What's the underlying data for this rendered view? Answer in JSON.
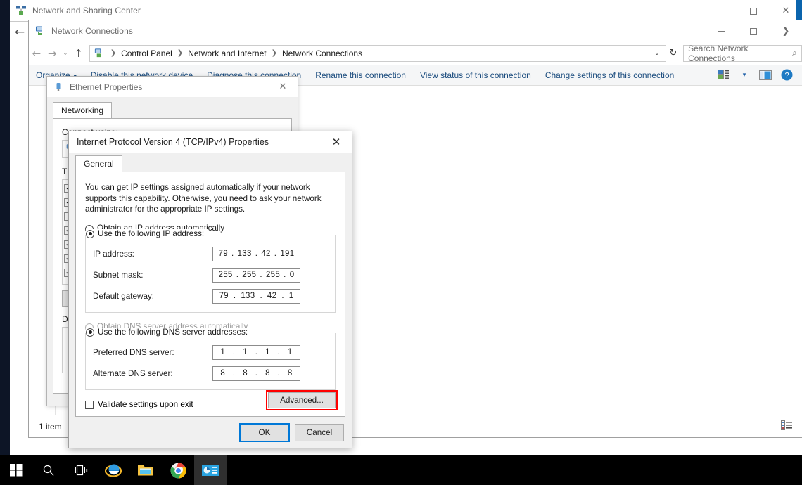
{
  "desktop": {
    "background_color": "#0d1526"
  },
  "nsc_window": {
    "title": "Network and Sharing Center",
    "icon": "network-sharing-icon",
    "controls": {
      "minimize": "–",
      "maximize": "□",
      "close": "✕"
    },
    "accent_color": "#0a64ad"
  },
  "nc_window": {
    "title": "Network Connections",
    "icon": "network-connections-icon",
    "controls": {
      "minimize": "–",
      "maximize": "□",
      "close": "❯"
    },
    "nav": {
      "back": "←",
      "forward": "→",
      "recent": "⌄",
      "up": "↑"
    },
    "breadcrumb": {
      "icon": "network-connections-icon",
      "items": [
        "Control Panel",
        "Network and Internet",
        "Network Connections"
      ],
      "separator": "❯",
      "dropdown": "⌄"
    },
    "refresh_icon": "↻",
    "search": {
      "placeholder": "Search Network Connections",
      "icon": "search-icon"
    },
    "commandbar": {
      "organize": "Organize",
      "organize_caret": "▾",
      "items": [
        "Disable this network device",
        "Diagnose this connection",
        "Rename this connection",
        "View status of this connection",
        "Change settings of this connection"
      ],
      "view_icon": "view-layout-icon",
      "view_caret": "▾",
      "preview_pane_icon": "preview-pane-icon",
      "help_icon": "help-icon"
    },
    "statusbar": {
      "item_count": "1 item",
      "details_view_icon": "details-view-icon",
      "large_icons_view_icon": "large-icons-view-icon"
    }
  },
  "ethernet_dialog": {
    "title": "Ethernet Properties",
    "icon": "ethernet-adapter-icon",
    "close": "✕",
    "tab": "Networking",
    "connect_using_label": "Connect using:",
    "adapter_name": "",
    "items_label": "This connection uses the following items:",
    "items": [
      {
        "label": "",
        "checked": true
      },
      {
        "label": "",
        "checked": true
      },
      {
        "label": "",
        "checked": false
      },
      {
        "label": "",
        "checked": true
      },
      {
        "label": "",
        "checked": true
      },
      {
        "label": "",
        "checked": true
      },
      {
        "label": "",
        "checked": true
      }
    ],
    "buttons": {
      "install": "",
      "uninstall": "",
      "properties": ""
    },
    "description_label": "Description",
    "footer": {
      "ok": "",
      "cancel": ""
    }
  },
  "ipv4_dialog": {
    "title": "Internet Protocol Version 4 (TCP/IPv4) Properties",
    "close": "✕",
    "tab": "General",
    "intro": "You can get IP settings assigned automatically if your network supports this capability. Otherwise, you need to ask your network administrator for the appropriate IP settings.",
    "ip_auto_label": "Obtain an IP address automatically",
    "ip_manual_label": "Use the following IP address:",
    "ip_mode": "manual",
    "fields": [
      {
        "label": "IP address:",
        "octets": [
          "79",
          "133",
          "42",
          "191"
        ]
      },
      {
        "label": "Subnet mask:",
        "octets": [
          "255",
          "255",
          "255",
          "0"
        ]
      },
      {
        "label": "Default gateway:",
        "octets": [
          "79",
          "133",
          "42",
          "1"
        ]
      }
    ],
    "dns_auto_label": "Obtain DNS server address automatically",
    "dns_auto_disabled": true,
    "dns_manual_label": "Use the following DNS server addresses:",
    "dns_mode": "manual",
    "dns_fields": [
      {
        "label": "Preferred DNS server:",
        "octets": [
          "1",
          "1",
          "1",
          "1"
        ]
      },
      {
        "label": "Alternate DNS server:",
        "octets": [
          "8",
          "8",
          "8",
          "8"
        ]
      }
    ],
    "validate_label": "Validate settings upon exit",
    "validate_checked": false,
    "advanced_label": "Advanced...",
    "advanced_highlight_color": "#ff0000",
    "ok_label": "OK",
    "cancel_label": "Cancel",
    "focus_color": "#0078d7"
  },
  "taskbar": {
    "background_color": "#000000",
    "items": [
      {
        "name": "start-button",
        "icon": "windows-logo-icon"
      },
      {
        "name": "search-button",
        "icon": "search-icon"
      },
      {
        "name": "task-view-button",
        "icon": "task-view-icon"
      },
      {
        "name": "internet-explorer-button",
        "icon": "internet-explorer-icon"
      },
      {
        "name": "file-explorer-button",
        "icon": "file-explorer-icon"
      },
      {
        "name": "chrome-button",
        "icon": "google-chrome-icon"
      },
      {
        "name": "network-connections-taskbar-button",
        "icon": "network-connections-icon",
        "active": true
      }
    ]
  }
}
